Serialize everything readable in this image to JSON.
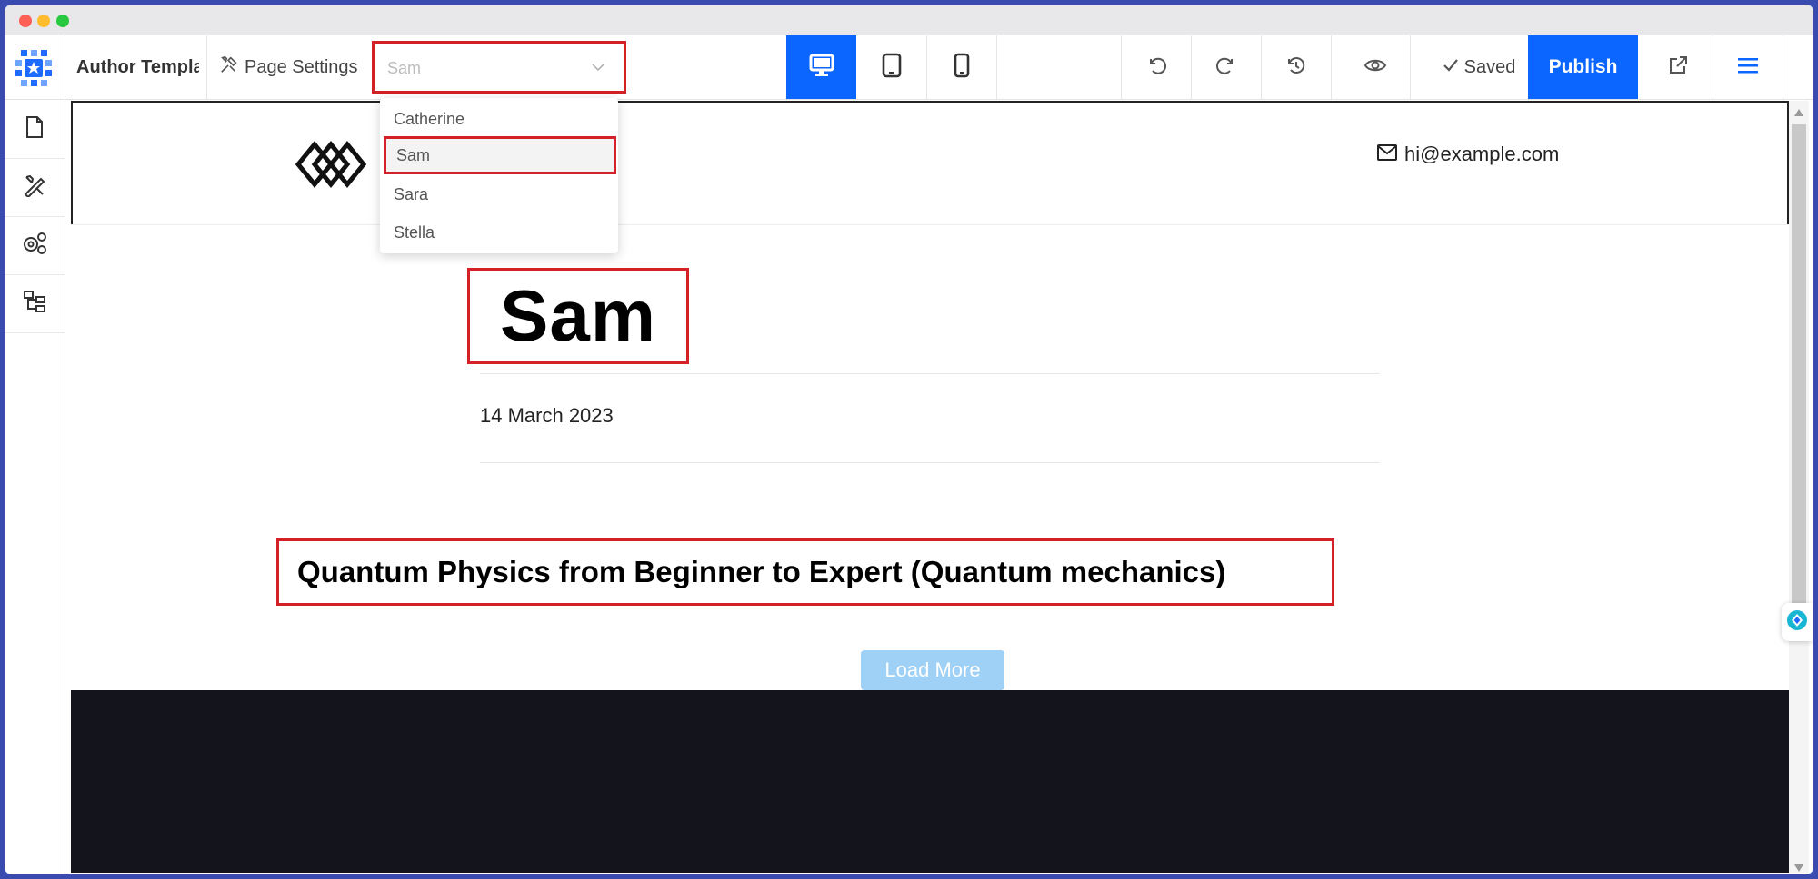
{
  "toolbar": {
    "app_title": "Author Template",
    "page_settings_label": "Page Settings",
    "select_value": "Sam",
    "saved_label": "Saved",
    "publish_label": "Publish"
  },
  "dropdown": {
    "options": [
      "Catherine",
      "Sam",
      "Sara",
      "Stella"
    ],
    "selected": "Sam"
  },
  "site": {
    "email": "hi@example.com",
    "author_name": "Sam",
    "date": "14 March 2023",
    "post_title": "Quantum Physics from Beginner to Expert (Quantum mechanics)",
    "load_more_label": "Load More"
  },
  "colors": {
    "accent": "#0a66ff",
    "highlight": "#d42027",
    "load_more": "#9fd1f7",
    "footer": "#14141c"
  }
}
